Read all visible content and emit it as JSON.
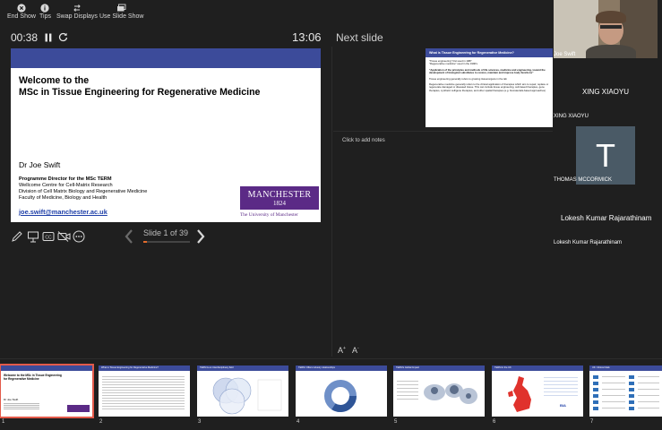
{
  "toolbar": {
    "end_show": "End Show",
    "tips": "Tips",
    "swap_displays": "Swap Displays",
    "use_slide_show": "Use Slide Show"
  },
  "presenter": {
    "elapsed": "00:38",
    "clock": "13:06",
    "next_slide_label": "Next slide",
    "notes_placeholder": "Click to add notes",
    "slide_counter": "Slide 1 of 39"
  },
  "current_slide": {
    "title_line1": "Welcome to the",
    "title_line2": "MSc in Tissue Engineering for Regenerative Medicine",
    "author": "Dr Joe Swift",
    "role_bold": "Programme Director for the MSc TERM",
    "role_line2": "Wellcome Centre for Cell-Matrix Research",
    "role_line3": "Division of Cell Matrix Biology and Regenerative Medicine",
    "role_line4": "Faculty of Medicine, Biology and Health",
    "email": "joe.swift@manchester.ac.uk",
    "logo_line1": "MANCHESTER",
    "logo_line2": "1824",
    "university": "The University of Manchester"
  },
  "next_slide": {
    "title": "What is Tissue Engineering for Regenerative Medicine?",
    "p1": "\"Tissue engineering\" first used in 1987",
    "p2": "\"Regenerative medicine\" used in the 1990's",
    "p3": "\"Application of the principles and methods of life sciences, medicine and engineering, toward the development of biological substitutes to restore, maintain and improve body functions\"",
    "p4": "Tissue engineering generally refers to growing tissue/organs in the lab",
    "p5": "Regenerative medicine generally refers to the clinical application of therapies which aim to repair, replace or regenerate damaged or diseased tissue. This can include tissue engineering, cell-based therapies, gene therapies, synthetic cell/gene therapies, and other spatial therapies (e.g. biomaterials-based approaches)"
  },
  "participants": {
    "p1": "Joe Swift",
    "p2_big": "XING XIAOYU",
    "p2": "XING XIAOYU",
    "p3_initial": "T",
    "p3": "THOMAS MCCORMICK",
    "p4_big": "Lokesh Kumar Rajarathinam",
    "p4": "Lokesh Kumar Rajarathinam"
  },
  "thumbnails": {
    "t1_title": "Welcome to the MSc in Tissue Engineering for Regenerative Medicine",
    "t1_author": "Dr Joe Swift",
    "t2_title": "What is Tissue Engineering for Regenerative Medicine?",
    "t3_title": "TERM is an interdisciplinary field",
    "t4_title": "TERM: Offers industry relationships",
    "t5_title": "TERM's Global Impact",
    "t6_title": "TERM in the UK",
    "t6_badge": "BIA",
    "t7_title": "UK: Clinical trials",
    "n1": "1",
    "n2": "2",
    "n3": "3",
    "n4": "4",
    "n5": "5",
    "n6": "6",
    "n7": "7"
  },
  "colors": {
    "background": "#1f1f1f",
    "slide_bar": "#3c4b9a",
    "manchester_purple": "#5b2a86",
    "selection": "#e35a4a"
  }
}
